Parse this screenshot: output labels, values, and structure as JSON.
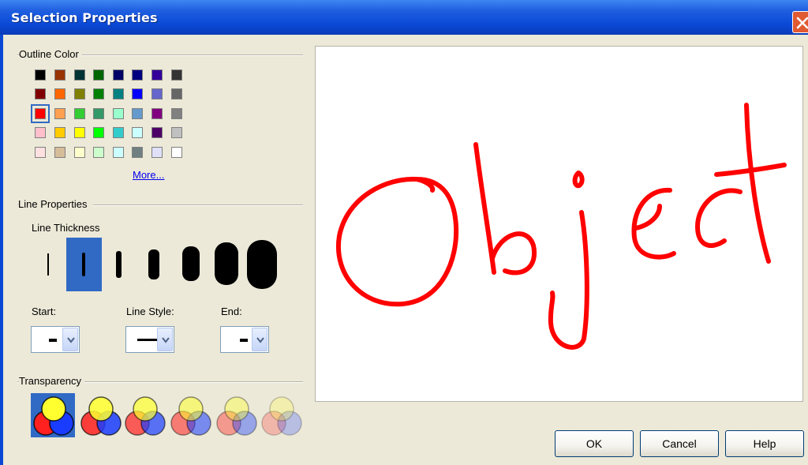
{
  "window": {
    "title": "Selection Properties"
  },
  "outline_color": {
    "label": "Outline Color",
    "swatches": [
      [
        "#000000",
        "#993300",
        "#003333",
        "#006600",
        "#000066",
        "#000080",
        "#330099",
        "#333333"
      ],
      [
        "#800000",
        "#ff6600",
        "#808000",
        "#008000",
        "#008080",
        "#0000ff",
        "#6666cc",
        "#666666"
      ],
      [
        "#ff0000",
        "#ffa050",
        "#33cc33",
        "#339966",
        "#99ffcc",
        "#6699cc",
        "#800080",
        "#808080"
      ],
      [
        "#ffc0cb",
        "#ffcc00",
        "#ffff00",
        "#00ff00",
        "#33cccc",
        "#ccffff",
        "#4d0066",
        "#c0c0c0"
      ],
      [
        "#ffe0e0",
        "#d6bd99",
        "#ffffcc",
        "#ccffcc",
        "#ccffff",
        "#708080",
        "#e0e0f8",
        "#ffffff"
      ]
    ],
    "selected_color": "#ff0000",
    "more_link": "More..."
  },
  "line_properties": {
    "label": "Line Properties",
    "thickness_label": "Line Thickness",
    "start_label": "Start:",
    "line_style_label": "Line Style:",
    "end_label": "End:"
  },
  "transparency": {
    "label": "Transparency"
  },
  "preview": {
    "text": "Object",
    "stroke_color": "#ff0000"
  },
  "buttons": {
    "ok": "OK",
    "cancel": "Cancel",
    "help": "Help"
  },
  "colors": {
    "accent": "#316ac5",
    "face": "#ece9d8",
    "title": "#0a49d6"
  }
}
